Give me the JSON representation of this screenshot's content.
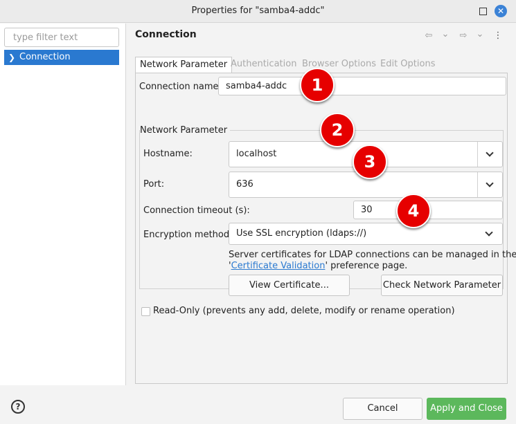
{
  "window": {
    "title": "Properties for \"samba4-addc\"",
    "close_glyph": "✕"
  },
  "sidebar": {
    "filter_placeholder": "type filter text",
    "items": [
      {
        "label": "Connection",
        "chevron": "❯"
      }
    ]
  },
  "page": {
    "title": "Connection",
    "nav": {
      "back": "⇦",
      "back_menu": "⌄",
      "forward": "⇨",
      "forward_menu": "⌄",
      "menu": "⋮"
    }
  },
  "tabs": [
    {
      "label": "Network Parameter",
      "active": true
    },
    {
      "label": "Authentication",
      "active": false
    },
    {
      "label": "Browser Options",
      "active": false
    },
    {
      "label": "Edit Options",
      "active": false
    }
  ],
  "form": {
    "connection_name_label": "Connection name:",
    "connection_name_value": "samba4-addc",
    "group_title": "Network Parameter",
    "hostname_label": "Hostname:",
    "hostname_value": "localhost",
    "port_label": "Port:",
    "port_value": "636",
    "timeout_label": "Connection timeout (s):",
    "timeout_value": "30",
    "encryption_label": "Encryption method:",
    "encryption_value": "Use SSL encryption (ldaps://)",
    "cert_info_line1": "Server certificates for LDAP connections can be managed in the",
    "cert_info_quote_open": "'",
    "cert_info_link": "Certificate Validation",
    "cert_info_rest": "' preference page.",
    "view_cert_button": "View Certificate...",
    "check_network_button": "Check Network Parameter",
    "readonly_label": "Read-Only (prevents any add, delete, modify or rename operation)"
  },
  "badges": [
    "1",
    "2",
    "3",
    "4"
  ],
  "footer": {
    "help_glyph": "?",
    "cancel": "Cancel",
    "apply_close": "Apply and Close"
  },
  "colors": {
    "selection": "#2a79d0",
    "badge": "#e60000",
    "primary_button": "#5cb85c"
  }
}
